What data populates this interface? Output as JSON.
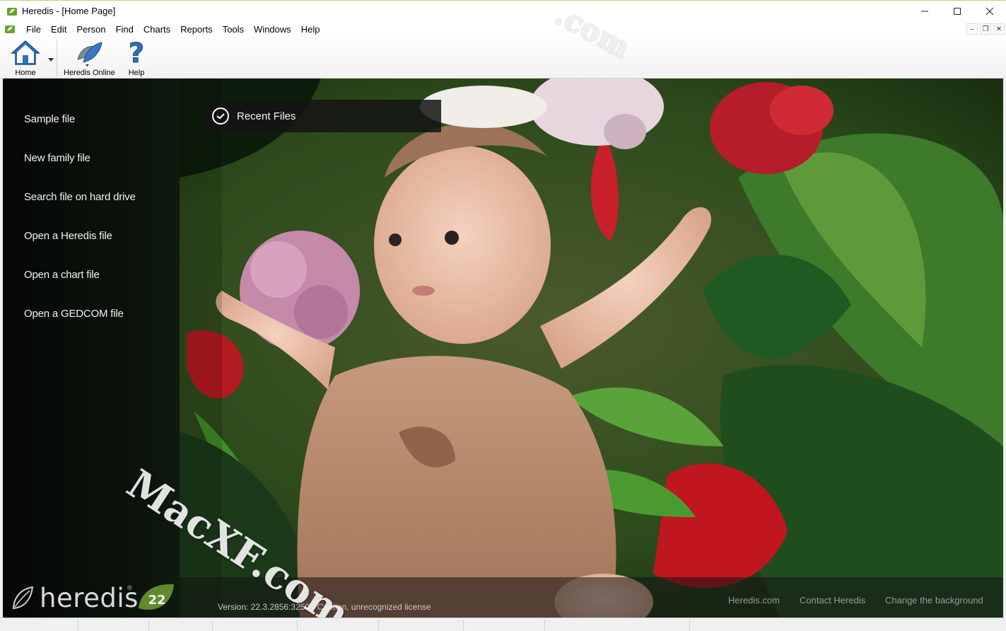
{
  "window": {
    "title": "Heredis - [Home Page]"
  },
  "menu": [
    "File",
    "Edit",
    "Person",
    "Find",
    "Charts",
    "Reports",
    "Tools",
    "Windows",
    "Help"
  ],
  "toolbar": {
    "home": "Home",
    "online": "Heredis Online",
    "help": "Help"
  },
  "sidebar": [
    "Sample file",
    "New family file",
    "Search file on hard drive",
    "Open a Heredis file",
    "Open a chart file",
    "Open a GEDCOM file"
  ],
  "recent": {
    "label": "Recent Files"
  },
  "logo": {
    "text": "heredis",
    "badge": "22"
  },
  "footer": {
    "version": "Version: 22.3.2856:3250 - Caution, unrecognized license",
    "links": [
      "Heredis.com",
      "Contact Heredis",
      "Change the background"
    ]
  },
  "watermark": {
    "main": "MacXF.com",
    "top": ".com"
  }
}
